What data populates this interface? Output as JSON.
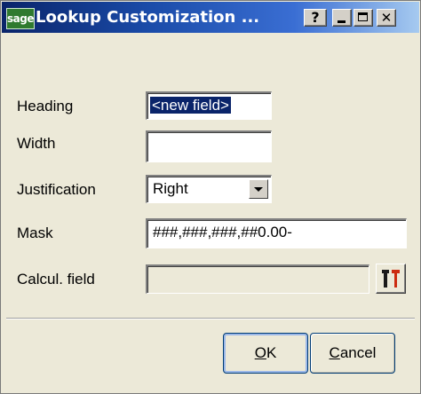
{
  "window": {
    "logo_text": "sage",
    "title": "Lookup Customization ...",
    "help_label": "?",
    "close_label": "✕"
  },
  "form": {
    "heading": {
      "label": "Heading",
      "value": "<new field>"
    },
    "width": {
      "label": "Width",
      "value": ""
    },
    "justification": {
      "label": "Justification",
      "value": "Right"
    },
    "mask": {
      "label": "Mask",
      "value": "###,###,###,##0.00-"
    },
    "calcul_field": {
      "label": "Calcul. field",
      "value": ""
    }
  },
  "buttons": {
    "ok_mnemonic": "O",
    "ok_rest": "K",
    "cancel_mnemonic": "C",
    "cancel_rest": "ancel"
  },
  "colors": {
    "title_gradient_start": "#0a246a",
    "selection": "#0a246a",
    "dialog_bg": "#ece9d8",
    "tool_icon_dark": "#1a1a1a",
    "tool_icon_red": "#cc2b10"
  },
  "icons": {
    "tool_button": "wrench-tools-icon",
    "justification_dropdown": "chevron-down-icon"
  }
}
